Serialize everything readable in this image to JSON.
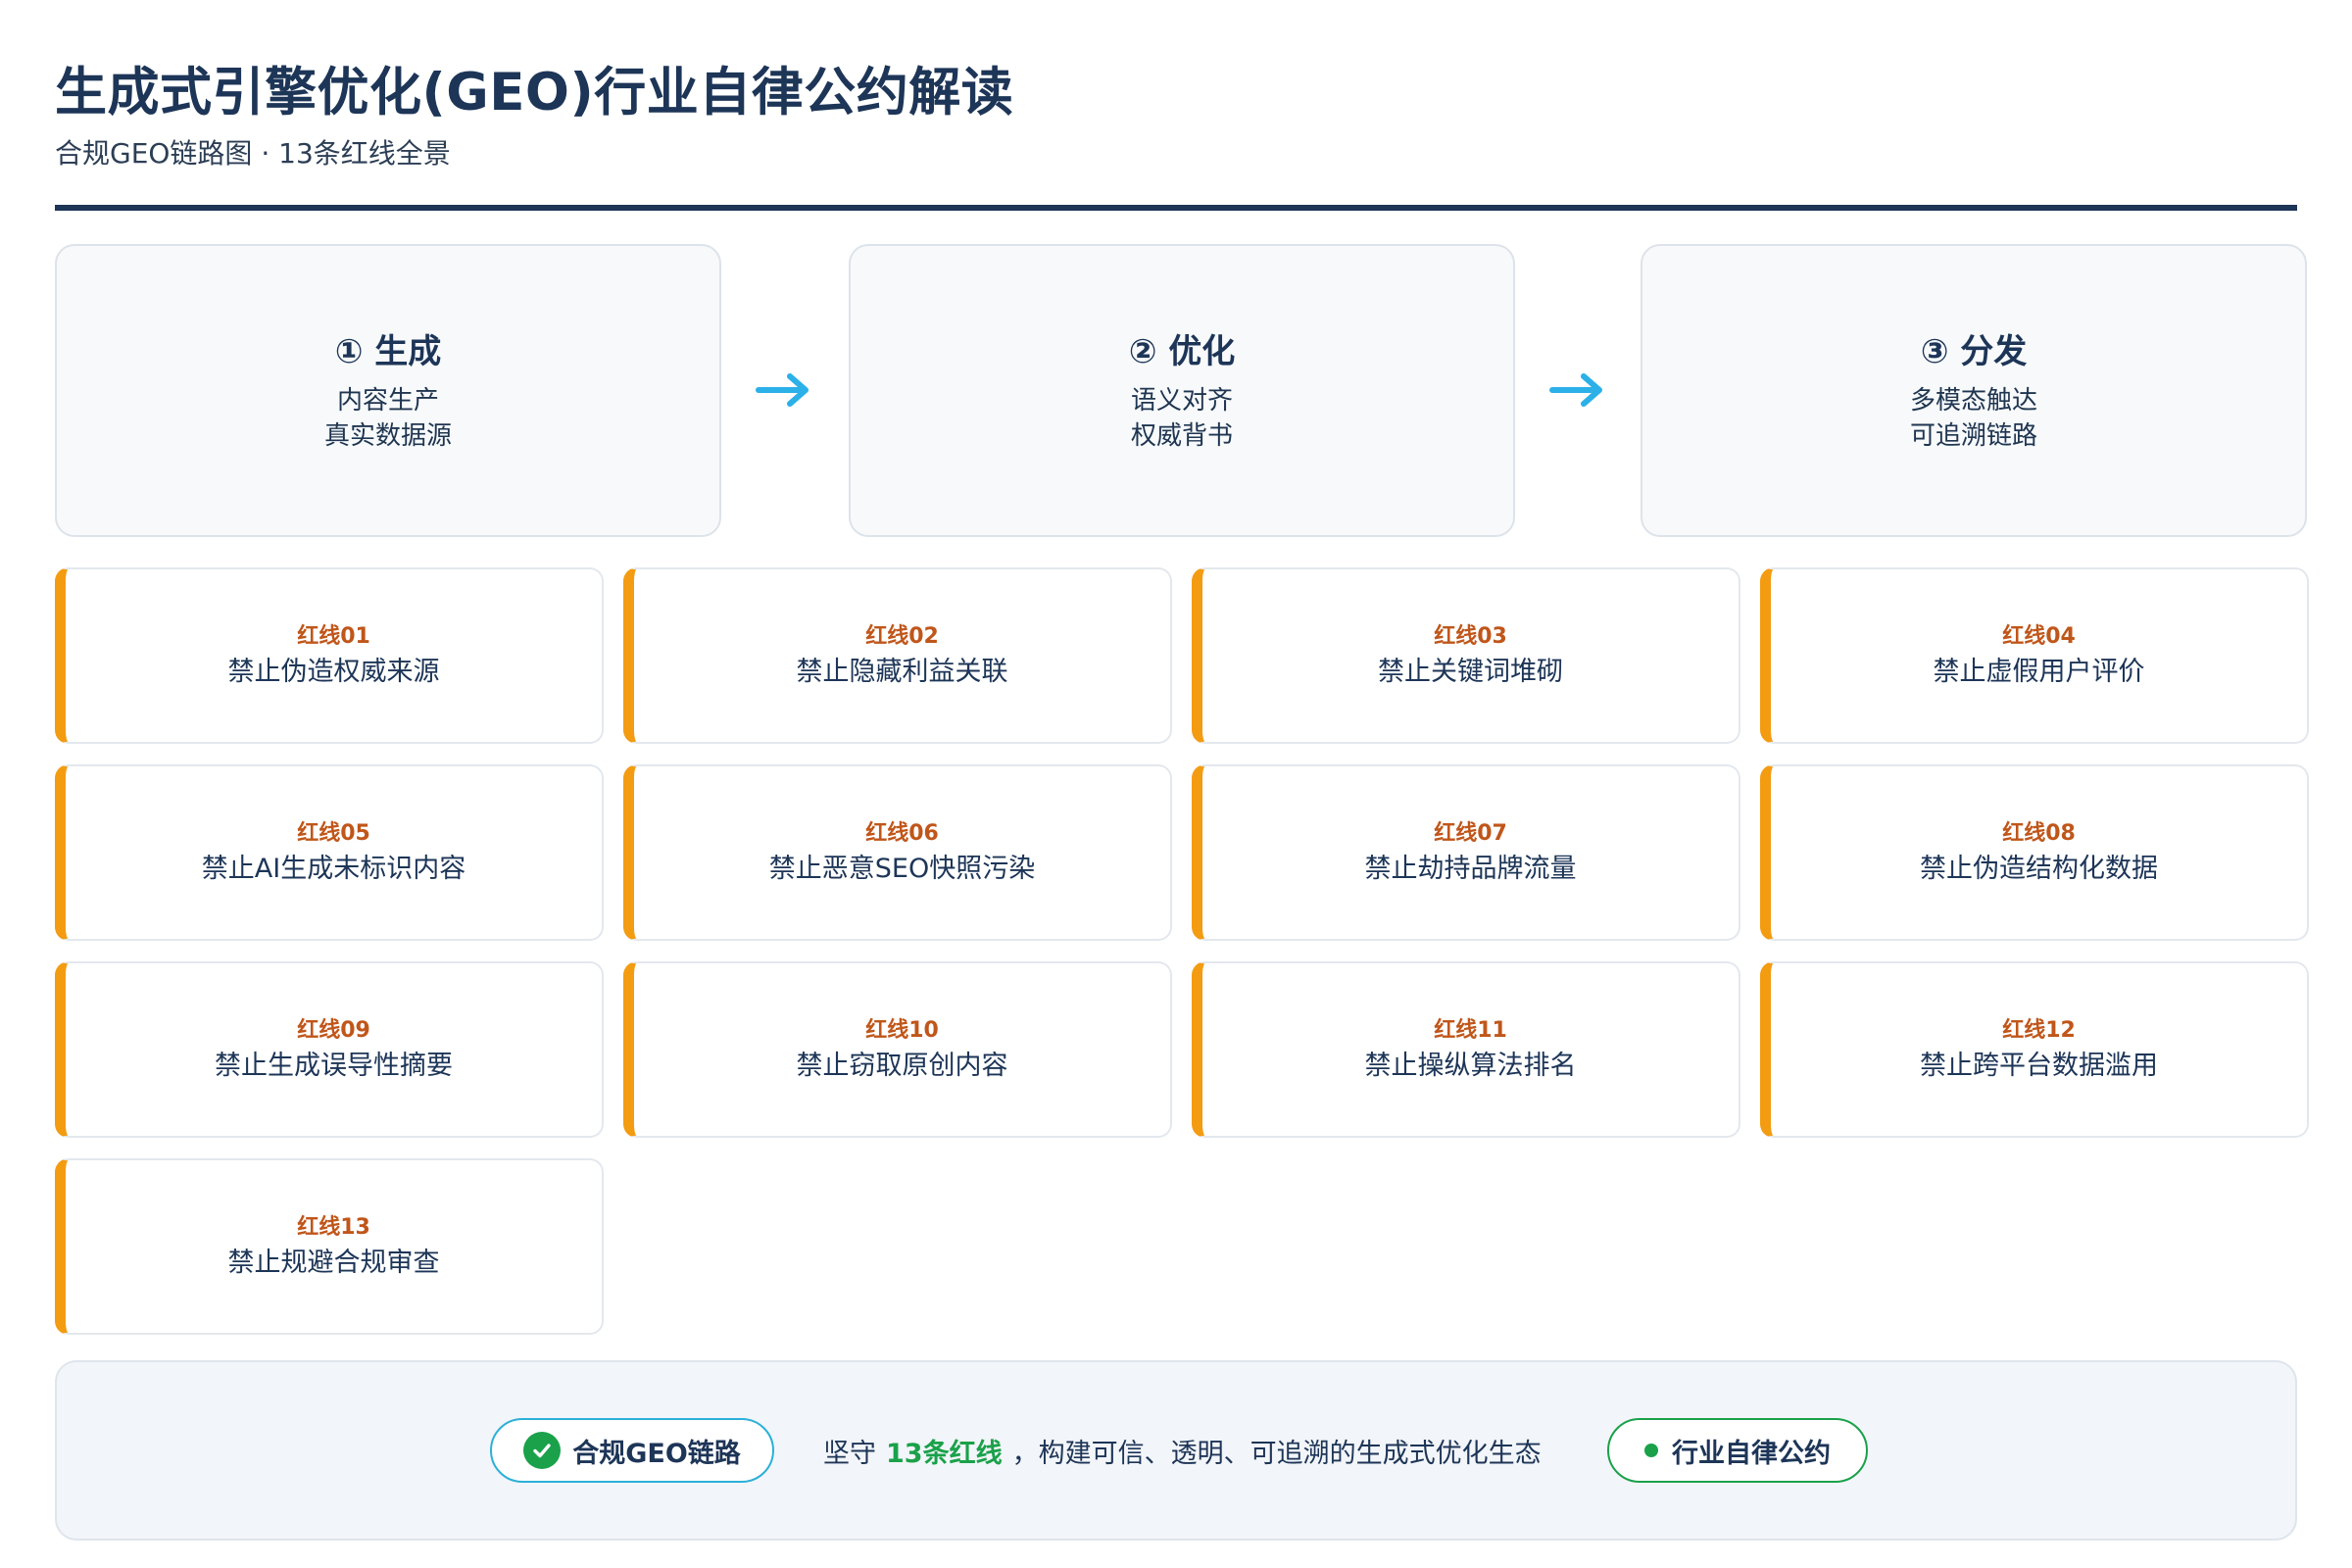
{
  "header": {
    "title": "生成式引擎优化(GEO)行业自律公约解读",
    "subtitle": "合规GEO链路图 · 13条红线全景"
  },
  "stages": [
    {
      "title": "① 生成",
      "line1": "内容生产",
      "line2": "真实数据源"
    },
    {
      "title": "② 优化",
      "line1": "语义对齐",
      "line2": "权威背书"
    },
    {
      "title": "③ 分发",
      "line1": "多模态触达",
      "line2": "可追溯链路"
    }
  ],
  "redlines": [
    {
      "code": "红线01",
      "text": "禁止伪造权威来源"
    },
    {
      "code": "红线02",
      "text": "禁止隐藏利益关联"
    },
    {
      "code": "红线03",
      "text": "禁止关键词堆砌"
    },
    {
      "code": "红线04",
      "text": "禁止虚假用户评价"
    },
    {
      "code": "红线05",
      "text": "禁止AI生成未标识内容"
    },
    {
      "code": "红线06",
      "text": "禁止恶意SEO快照污染"
    },
    {
      "code": "红线07",
      "text": "禁止劫持品牌流量"
    },
    {
      "code": "红线08",
      "text": "禁止伪造结构化数据"
    },
    {
      "code": "红线09",
      "text": "禁止生成误导性摘要"
    },
    {
      "code": "红线10",
      "text": "禁止窃取原创内容"
    },
    {
      "code": "红线11",
      "text": "禁止操纵算法排名"
    },
    {
      "code": "红线12",
      "text": "禁止跨平台数据滥用"
    },
    {
      "code": "红线13",
      "text": "禁止规避合规审查"
    }
  ],
  "footer": {
    "left_pill": "合规GEO链路",
    "statement_pre": "坚守",
    "statement_highlight": "13条红线",
    "statement_post": "，构建可信、透明、可追溯的生成式优化生态",
    "right_pill": "行业自律公约"
  },
  "colors": {
    "navy": "#1d3557",
    "accent_orange": "#f39c12",
    "code_orange": "#c0561a",
    "arrow_blue": "#2bb0e8",
    "green": "#1aa14a"
  },
  "icons": {
    "flow_arrow": "arrow-right-icon",
    "check": "check-circle-icon",
    "dot": "status-dot-icon"
  }
}
